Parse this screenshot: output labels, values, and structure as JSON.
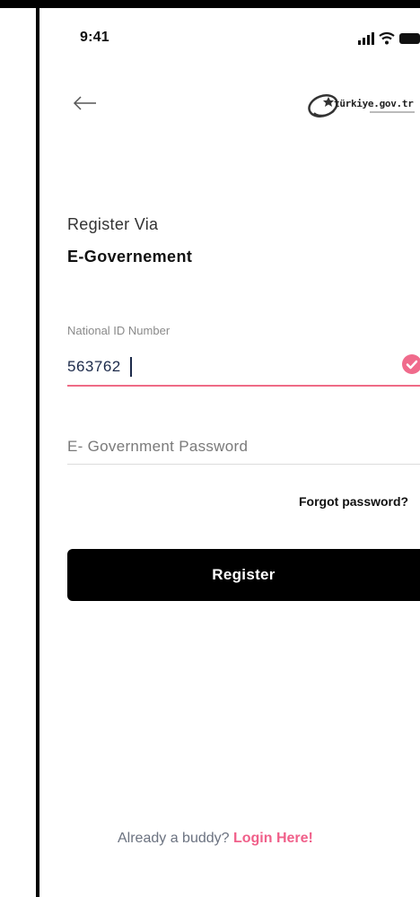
{
  "status_bar": {
    "time": "9:41",
    "icons": [
      "signal-icon",
      "wifi-icon",
      "battery-icon"
    ]
  },
  "header": {
    "back_icon": "arrow-left-icon",
    "logo_text": "türkiye.gov.tr"
  },
  "heading": {
    "line1": "Register Via",
    "line2": "E-Governement"
  },
  "national_id": {
    "label": "National ID Number",
    "value": "563762",
    "validated": true
  },
  "password": {
    "placeholder": "E- Government Password",
    "value": ""
  },
  "forgot_password": "Forgot password?",
  "register_button": "Register",
  "footer": {
    "text": "Already a buddy?",
    "link": "Login Here!"
  },
  "colors": {
    "accent": "#f0608a",
    "primary_button": "#000000",
    "input_text": "#1c2a4a"
  }
}
